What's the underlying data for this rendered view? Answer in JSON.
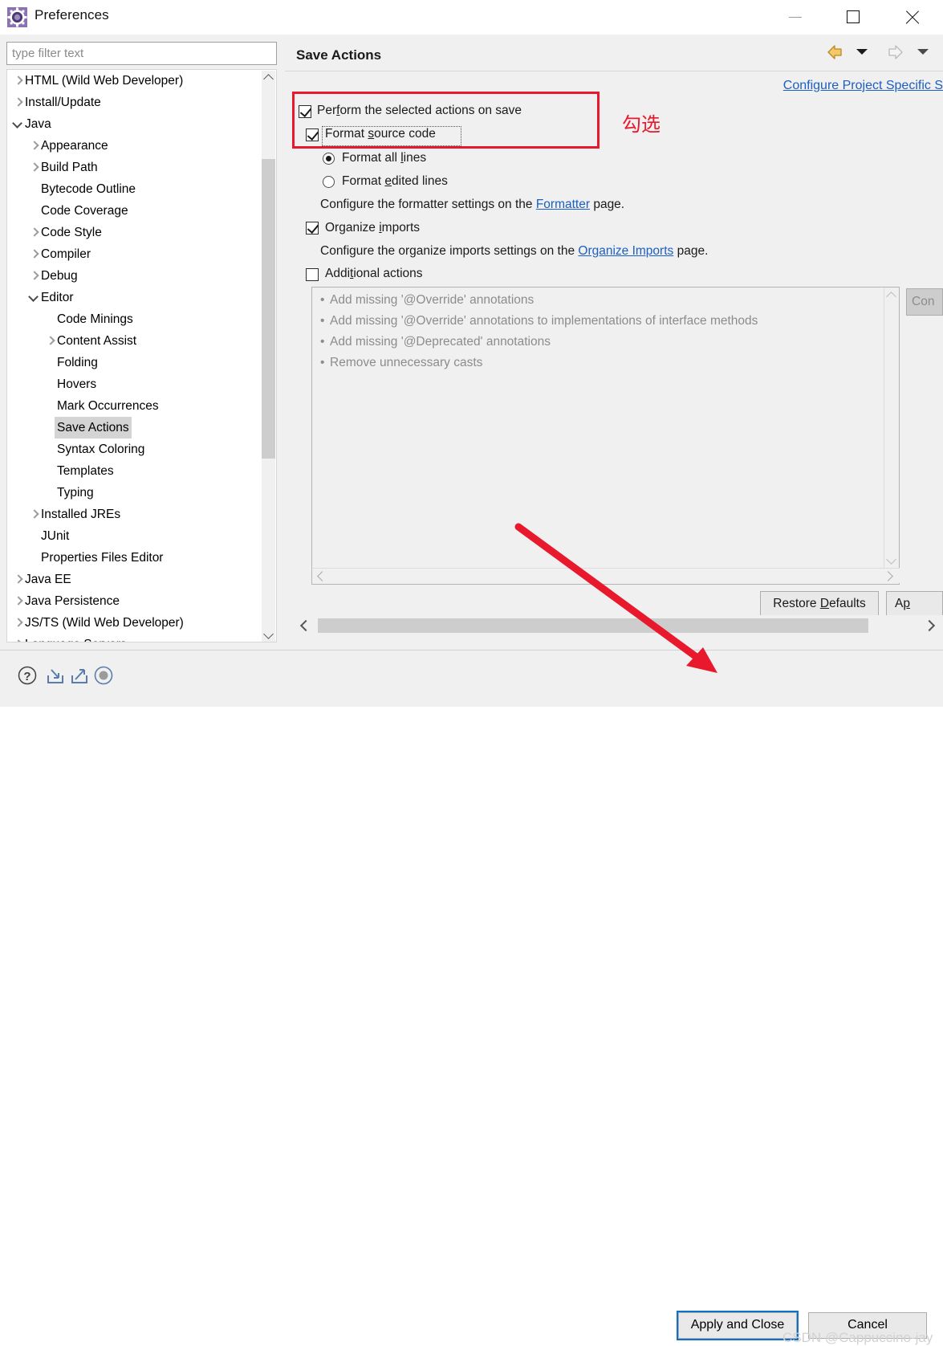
{
  "window": {
    "title": "Preferences",
    "icon": "preferences-gear-icon",
    "minimize_label": "Minimize",
    "maximize_label": "Maximize",
    "close_label": "Close"
  },
  "sidebar": {
    "filter": {
      "value": "",
      "placeholder": "type filter text"
    },
    "items": [
      {
        "label": "HTML (Wild Web Developer)",
        "indent": 0,
        "twisty": "closed",
        "selected": false
      },
      {
        "label": "Install/Update",
        "indent": 0,
        "twisty": "closed",
        "selected": false
      },
      {
        "label": "Java",
        "indent": 0,
        "twisty": "open",
        "selected": false
      },
      {
        "label": "Appearance",
        "indent": 1,
        "twisty": "closed",
        "selected": false
      },
      {
        "label": "Build Path",
        "indent": 1,
        "twisty": "closed",
        "selected": false
      },
      {
        "label": "Bytecode Outline",
        "indent": 1,
        "twisty": "none",
        "selected": false
      },
      {
        "label": "Code Coverage",
        "indent": 1,
        "twisty": "none",
        "selected": false
      },
      {
        "label": "Code Style",
        "indent": 1,
        "twisty": "closed",
        "selected": false
      },
      {
        "label": "Compiler",
        "indent": 1,
        "twisty": "closed",
        "selected": false
      },
      {
        "label": "Debug",
        "indent": 1,
        "twisty": "closed",
        "selected": false
      },
      {
        "label": "Editor",
        "indent": 1,
        "twisty": "open",
        "selected": false
      },
      {
        "label": "Code Minings",
        "indent": 2,
        "twisty": "none",
        "selected": false
      },
      {
        "label": "Content Assist",
        "indent": 2,
        "twisty": "closed",
        "selected": false
      },
      {
        "label": "Folding",
        "indent": 2,
        "twisty": "none",
        "selected": false
      },
      {
        "label": "Hovers",
        "indent": 2,
        "twisty": "none",
        "selected": false
      },
      {
        "label": "Mark Occurrences",
        "indent": 2,
        "twisty": "none",
        "selected": false
      },
      {
        "label": "Save Actions",
        "indent": 2,
        "twisty": "none",
        "selected": true
      },
      {
        "label": "Syntax Coloring",
        "indent": 2,
        "twisty": "none",
        "selected": false
      },
      {
        "label": "Templates",
        "indent": 2,
        "twisty": "none",
        "selected": false
      },
      {
        "label": "Typing",
        "indent": 2,
        "twisty": "none",
        "selected": false
      },
      {
        "label": "Installed JREs",
        "indent": 1,
        "twisty": "closed",
        "selected": false
      },
      {
        "label": "JUnit",
        "indent": 1,
        "twisty": "none",
        "selected": false
      },
      {
        "label": "Properties Files Editor",
        "indent": 1,
        "twisty": "none",
        "selected": false
      },
      {
        "label": "Java EE",
        "indent": 0,
        "twisty": "closed",
        "selected": false
      },
      {
        "label": "Java Persistence",
        "indent": 0,
        "twisty": "closed",
        "selected": false
      },
      {
        "label": "JS/TS (Wild Web Developer)",
        "indent": 0,
        "twisty": "closed",
        "selected": false
      },
      {
        "label": "Language Servers",
        "indent": 0,
        "twisty": "closed",
        "selected": false
      }
    ]
  },
  "page": {
    "title": "Save Actions",
    "configure_project_link": "Configure Project Specific S",
    "toolbar": {
      "back_icon": "back-arrow-icon",
      "back_menu_icon": "chevron-down-icon",
      "forward_icon": "forward-arrow-icon",
      "forward_menu_icon": "chevron-down-icon",
      "view_menu_icon": "vertical-dots-icon"
    },
    "perform_on_save": {
      "label": "Perform the selected actions on save",
      "mnemonic": "f",
      "checked": true
    },
    "format_source": {
      "label": "Format source code",
      "mnemonic": "s",
      "checked": true
    },
    "format_all_lines": {
      "label": "Format all lines",
      "mnemonic": "l",
      "selected": true
    },
    "format_edited_lines": {
      "label": "Format edited lines",
      "mnemonic": "e",
      "selected": false
    },
    "formatter_hint_prefix": "Configure the formatter settings on the ",
    "formatter_link": "Formatter",
    "formatter_hint_suffix": " page.",
    "organize_imports": {
      "label": "Organize imports",
      "mnemonic": "i",
      "checked": true
    },
    "organize_hint_prefix": "Configure the organize imports settings on the ",
    "organize_link": "Organize Imports",
    "organize_hint_suffix": " page.",
    "additional_actions": {
      "label": "Additional actions",
      "mnemonic": "t",
      "checked": false
    },
    "additional_items": [
      "Add missing '@Override' annotations",
      "Add missing '@Override' annotations to implementations of interface methods",
      "Add missing '@Deprecated' annotations",
      "Remove unnecessary casts"
    ],
    "configure_button": "Con",
    "restore_defaults_button": {
      "label": "Restore Defaults",
      "mnemonic": "D"
    },
    "apply_button": {
      "label": "Ap",
      "mnemonic": "p"
    }
  },
  "footer": {
    "help_icon": "help-question-icon",
    "import_icon": "import-icon",
    "export_icon": "export-icon",
    "record_icon": "record-circle-icon",
    "apply_and_close_button": "Apply and Close",
    "cancel_button": "Cancel",
    "watermark": "CSDN @Cappuccino-jay"
  },
  "annotations": {
    "check_note": "勾选",
    "highlight_color": "#e8192c",
    "arrow_color": "#e8192c",
    "focus_color": "#0a72cc"
  }
}
